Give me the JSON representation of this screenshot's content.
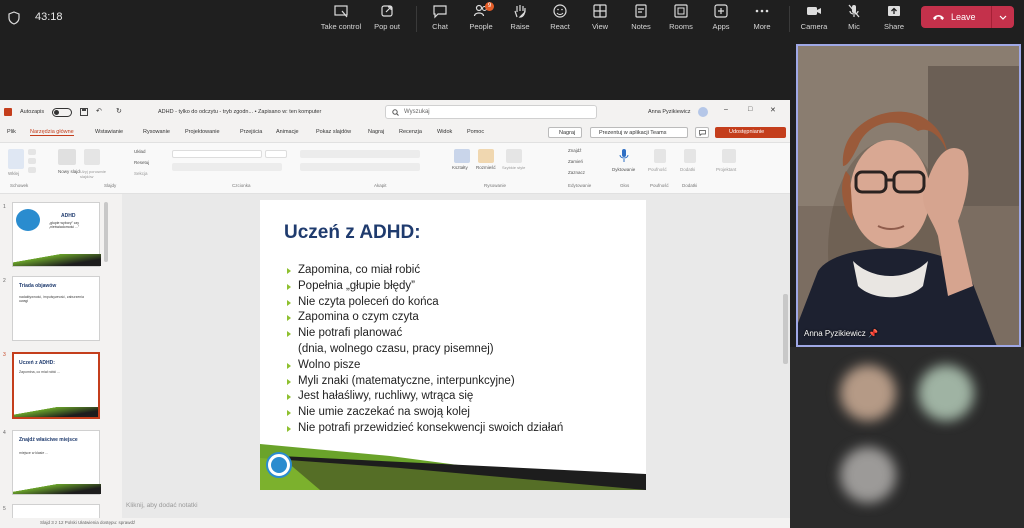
{
  "meeting": {
    "elapsed": "43:18",
    "toolbar": [
      {
        "label": "Take control",
        "icon": "take-control-icon"
      },
      {
        "label": "Pop out",
        "icon": "pop-out-icon"
      },
      {
        "label": "Chat",
        "icon": "chat-icon"
      },
      {
        "label": "People",
        "icon": "people-icon",
        "badge": "9"
      },
      {
        "label": "Raise",
        "icon": "raise-hand-icon"
      },
      {
        "label": "React",
        "icon": "react-icon"
      },
      {
        "label": "View",
        "icon": "view-icon"
      },
      {
        "label": "Notes",
        "icon": "notes-icon"
      },
      {
        "label": "Rooms",
        "icon": "rooms-icon"
      },
      {
        "label": "Apps",
        "icon": "apps-icon"
      },
      {
        "label": "More",
        "icon": "more-icon"
      },
      {
        "label": "Camera",
        "icon": "camera-icon"
      },
      {
        "label": "Mic",
        "icon": "mic-icon"
      },
      {
        "label": "Share",
        "icon": "share-icon"
      }
    ],
    "leave_label": "Leave",
    "leave_color": "#c4314b",
    "participant_name": "Anna Pyzikiewicz"
  },
  "ppt": {
    "title_bar": {
      "autosave": "Autozapis",
      "doc_title": "ADHD - tylko do odczytu - tryb zgodn... • Zapisano w: ten komputer",
      "search_placeholder": "Wyszukaj",
      "user": "Anna Pyzikiewicz"
    },
    "menu": [
      "Plik",
      "Narzędzia główne",
      "Wstawianie",
      "Rysowanie",
      "Projektowanie",
      "Przejścia",
      "Animacje",
      "Pokaz slajdów",
      "Nagraj",
      "Recenzja",
      "Widok",
      "Pomoc"
    ],
    "menu_right": {
      "record": "Nagraj",
      "present_teams": "Prezentuj w aplikacji Teams",
      "share": "Udostępnianie"
    },
    "ribbon_groups": [
      "Schowek",
      "Slajdy",
      "Czcionka",
      "Akapit",
      "Rysowanie",
      "Edytowanie",
      "Głos",
      "Poufność",
      "Dodatki"
    ],
    "ribbon_buttons": {
      "paste": "Wklej",
      "new_slide": "Nowy slajd",
      "reuse": "Użyj ponownie slajdów",
      "layout": "Układ",
      "reset": "Resetuj",
      "section": "Sekcja",
      "shapes": "Kształty",
      "arrange": "Rozmieść",
      "styles": "Szybkie style",
      "find": "Znajdź",
      "replace": "Zamień",
      "select": "Zaznacz",
      "dictate": "Dyktowanie",
      "sensitivity": "Poufność",
      "addins": "Dodatki",
      "designer": "Projektant"
    },
    "thumbnails": [
      {
        "num": "1",
        "title": "ADHD",
        "text": "„głupie wybory” czy „nieświadomość ...”",
        "selected": false
      },
      {
        "num": "2",
        "title": "Triada objawów",
        "text": "nadaktywność, impulsywność, zaburzenia uwagi",
        "selected": false
      },
      {
        "num": "3",
        "title": "Uczeń z ADHD:",
        "text": "Zapomina, co miał robić ...",
        "selected": true
      },
      {
        "num": "4",
        "title": "Znajdź właściwe miejsce",
        "text": "miejsce w klasie ...",
        "selected": false
      },
      {
        "num": "5",
        "title": "",
        "text": "",
        "selected": false
      }
    ],
    "slide": {
      "title": "Uczeń z ADHD:",
      "bullets": [
        "Zapomina, co miał robić",
        "Popełnia „głupie błędy”",
        "Nie czyta poleceń do końca",
        "Zapomina o czym czyta",
        "Nie potrafi planować",
        "(dnia, wolnego czasu, pracy pisemnej)",
        "Wolno pisze",
        "Myli znaki (matematyczne, interpunkcyjne)",
        "Jest hałaśliwy, ruchliwy, wtrąca się",
        "Nie umie zaczekać na swoją kolej",
        "Nie potrafi przewidzieć konsekwencji swoich działań"
      ],
      "accent_green": "#8ec02f",
      "title_color": "#1f3b6e"
    },
    "notes_placeholder": "Kliknij, aby dodać notatki",
    "status": "Slajd 3 z 12  Polski  Ułatwienia dostępu: sprawdź"
  }
}
